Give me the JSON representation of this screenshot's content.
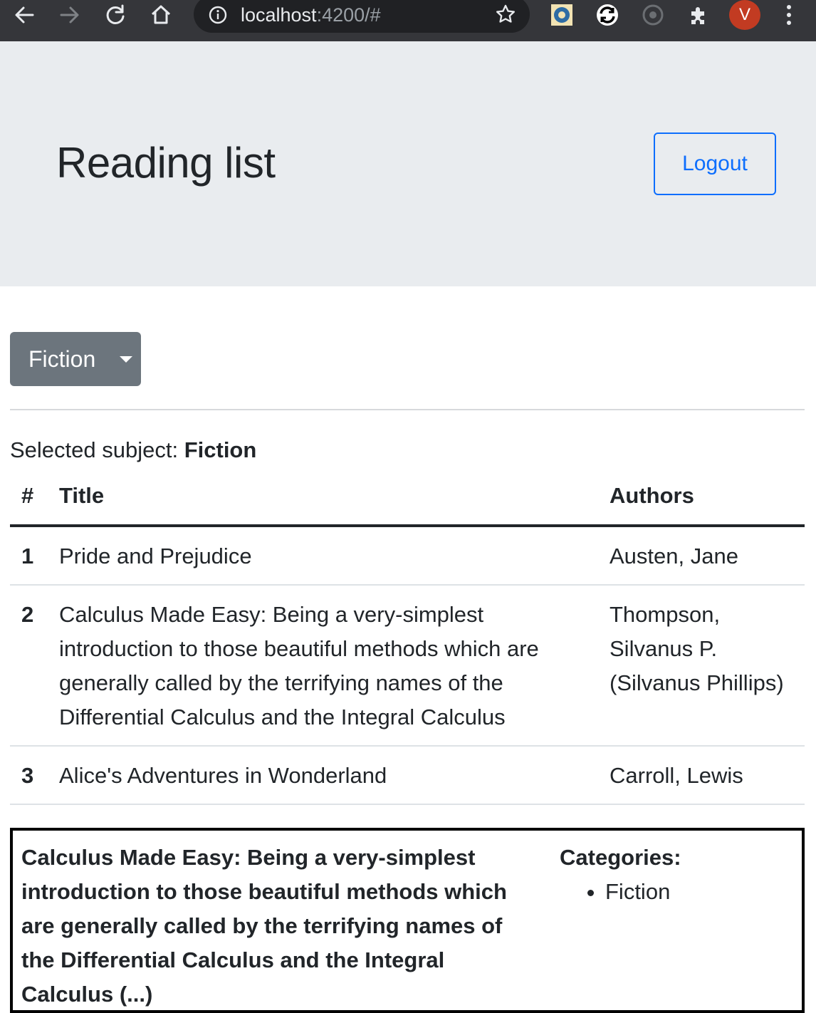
{
  "browser": {
    "url_host": "localhost",
    "url_rest": ":4200/#",
    "profile_initial": "V",
    "icons": [
      "back-icon",
      "forward-icon",
      "reload-icon",
      "home-icon",
      "info-icon",
      "star-icon",
      "extension-icon",
      "menu-icon"
    ]
  },
  "header": {
    "title": "Reading list",
    "logout_label": "Logout"
  },
  "subject": {
    "dropdown_label": "Fiction",
    "selected_prefix": "Selected subject: ",
    "selected_value": "Fiction"
  },
  "table": {
    "columns": [
      "#",
      "Title",
      "Authors"
    ],
    "rows": [
      {
        "num": "1",
        "title": "Pride and Prejudice",
        "author": "Austen, Jane"
      },
      {
        "num": "2",
        "title": "Calculus Made Easy: Being a very-simplest introduction to those beautiful methods which are generally called by the terrifying names of the Differential Calculus and the Integral Calculus",
        "author": "Thompson, Silvanus P. (Silvanus Phillips)"
      },
      {
        "num": "3",
        "title": "Alice's Adventures in Wonderland",
        "author": "Carroll, Lewis"
      }
    ]
  },
  "detail": {
    "title": "Calculus Made Easy: Being a very-simplest introduction to those beautiful methods which are generally called by the terrifying names of the Differential Calculus and the Integral Calculus (...)",
    "categories_label": "Categories:",
    "categories": [
      "Fiction"
    ]
  },
  "colors": {
    "chrome_bg": "#35363a",
    "header_bg": "#e9ecef",
    "primary": "#0d6efd",
    "secondary": "#6c757d",
    "avatar": "#c23b22"
  }
}
